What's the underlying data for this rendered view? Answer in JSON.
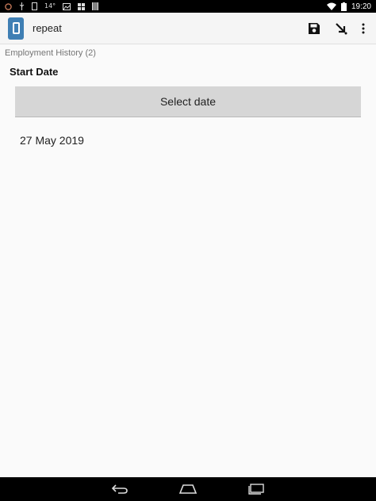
{
  "status_bar": {
    "time": "19:20",
    "temperature": "14°",
    "left_icons": [
      "messenger-icon",
      "usb-icon",
      "sim-icon",
      "temperature-icon",
      "image-icon",
      "grid-icon",
      "storage-icon"
    ],
    "right_icons": [
      "wifi-icon",
      "battery-icon"
    ]
  },
  "app_bar": {
    "title": "repeat",
    "actions": [
      "save-icon",
      "go-to-icon",
      "overflow-menu-icon"
    ]
  },
  "form": {
    "breadcrumb": "Employment History (2)",
    "field_label": "Start Date",
    "select_button_label": "Select date",
    "date_value": "27 May 2019"
  },
  "nav_bar": {
    "buttons": [
      "back-icon",
      "home-icon",
      "recent-apps-icon"
    ]
  },
  "colors": {
    "accent": "#3f7fb4",
    "button_bg": "#d6d6d6",
    "background": "#fafafa"
  }
}
